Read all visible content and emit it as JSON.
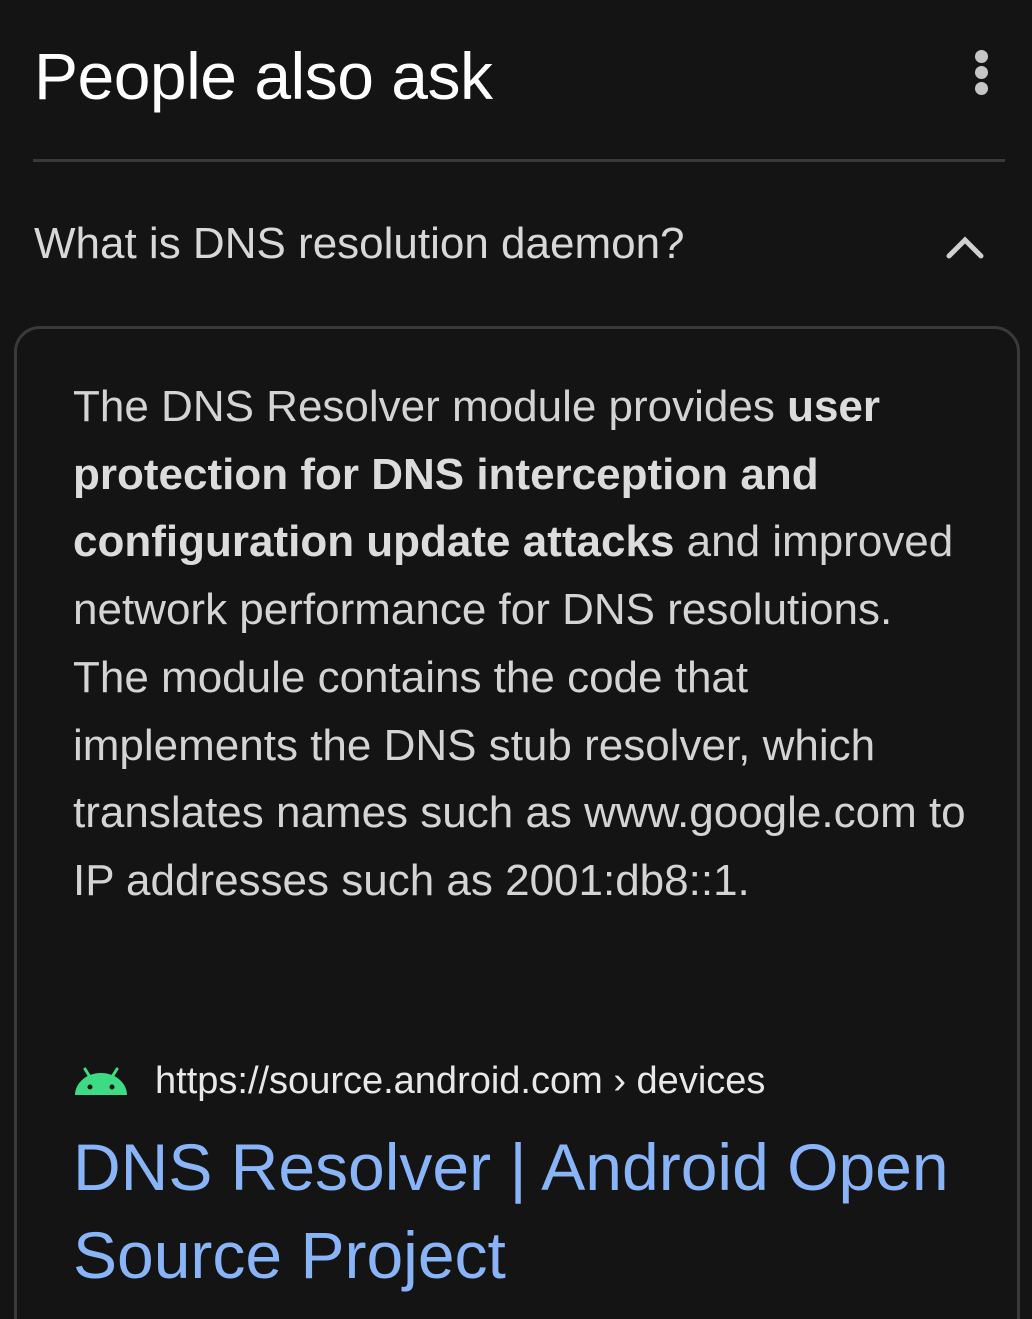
{
  "header": {
    "title": "People also ask",
    "menu_icon": "more-vert-icon"
  },
  "question": {
    "text": "What is DNS resolution daemon?",
    "toggle_icon": "chevron-up-icon",
    "expanded": true
  },
  "answer": {
    "text_before": "The DNS Resolver module provides ",
    "text_bold": "user protection for DNS interception and configuration update attacks",
    "text_after": " and improved network performance for DNS resolutions. The module contains the code that implements the DNS stub resolver, which translates names such as www.google.com to IP addresses such as 2001:db8::1."
  },
  "source": {
    "icon": "android-icon",
    "icon_color": "#3ddc84",
    "url": "https://source.android.com › devices",
    "title": "DNS Resolver | Android Open Source Project"
  },
  "colors": {
    "background": "#141414",
    "divider": "#3a3a3a",
    "link": "#8ab4f8"
  }
}
